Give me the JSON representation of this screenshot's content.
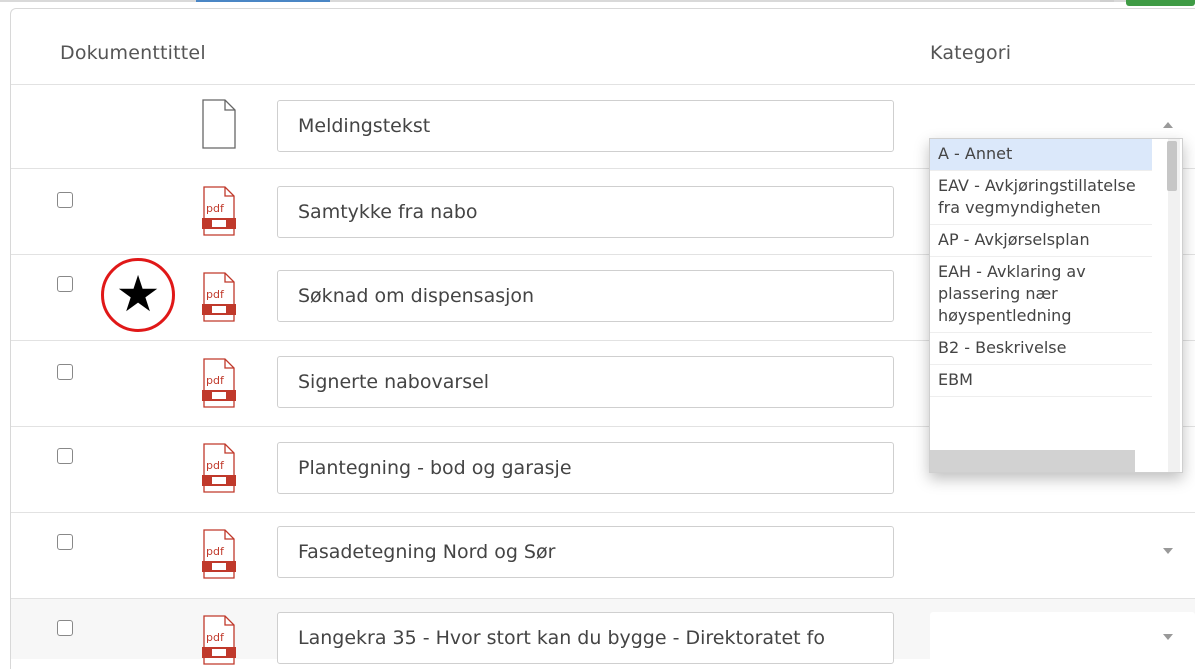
{
  "headers": {
    "title": "Dokumenttittel",
    "category": "Kategori"
  },
  "rows": [
    {
      "type": "text",
      "name": "Meldingstekst",
      "has_checkbox": false,
      "dropdown_open": true
    },
    {
      "type": "pdf",
      "name": "Samtykke fra nabo",
      "has_checkbox": true
    },
    {
      "type": "pdf",
      "name": "Søknad om dispensasjon",
      "has_checkbox": true,
      "marked_with_star": true
    },
    {
      "type": "pdf",
      "name": "Signerte nabovarsel",
      "has_checkbox": true
    },
    {
      "type": "pdf",
      "name": "Plantegning - bod og garasje",
      "has_checkbox": true
    },
    {
      "type": "pdf",
      "name": "Fasadetegning Nord og Sør",
      "has_checkbox": true
    },
    {
      "type": "pdf",
      "name": "Langekra 35 - Hvor stort kan du bygge - Direktoratet fo",
      "has_checkbox": true
    }
  ],
  "dropdown": {
    "selected": "A - Annet",
    "options": [
      "A - Annet",
      "EAV - Avkjøringstillatelse fra vegmyndigheten",
      "AP - Avkjørselsplan",
      "EAH - Avklaring av plassering nær høyspentledning",
      "B2 - Beskrivelse",
      "EBM"
    ]
  },
  "star_marker": "★",
  "icons": {
    "text_file": "document-icon",
    "pdf_file": "pdf-icon"
  },
  "colors": {
    "accent": "#4a86c5",
    "green_button": "#3f9b45",
    "pdf_red": "#c0392b",
    "marker_red": "#e01818",
    "selected_option": "#dbe8fa"
  }
}
